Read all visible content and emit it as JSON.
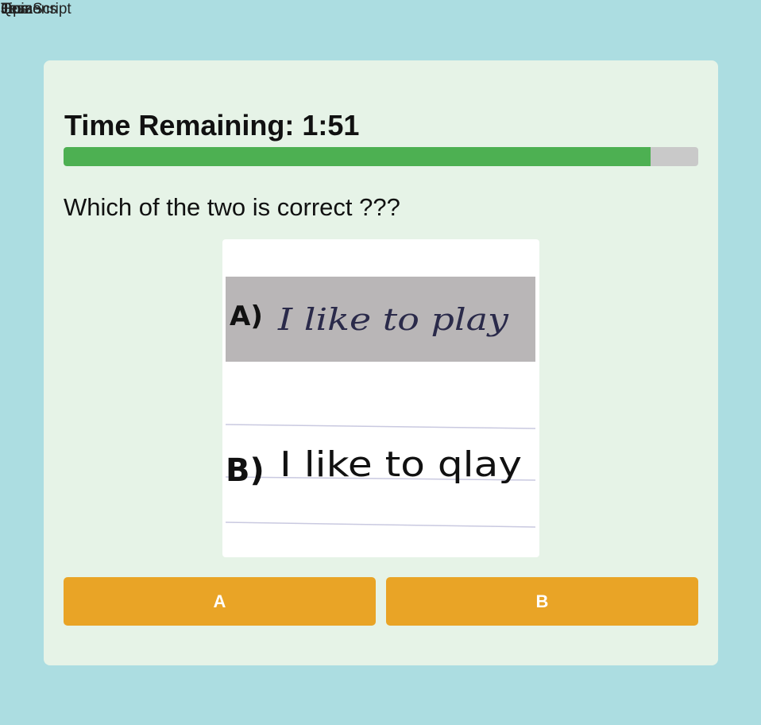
{
  "overlapped_labels": [
    "JavaScript",
    "Home",
    "Lessons",
    "Quiz",
    "Tips"
  ],
  "timer": {
    "label": "Time Remaining: 1:51",
    "progress_fraction": 0.925
  },
  "question": {
    "text": "Which of the two is correct ???"
  },
  "image": {
    "option_a_label": "A)",
    "option_a_text": "I like to play",
    "option_b_label": "B)",
    "option_b_text": "I like to qlay"
  },
  "answers": [
    {
      "label": "A"
    },
    {
      "label": "B"
    }
  ],
  "colors": {
    "background": "#acdde1",
    "card": "#e6f3e7",
    "progress_fill": "#4db052",
    "progress_track": "#c9c9c9",
    "answer_button": "#e9a426"
  }
}
